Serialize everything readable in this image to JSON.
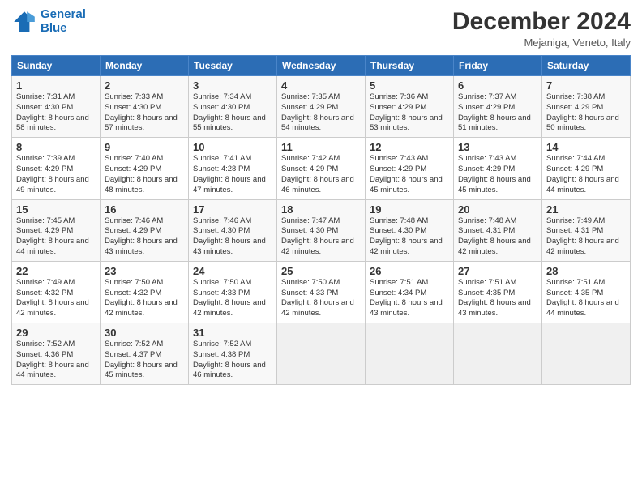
{
  "logo": {
    "line1": "General",
    "line2": "Blue"
  },
  "title": "December 2024",
  "subtitle": "Mejaniga, Veneto, Italy",
  "days_header": [
    "Sunday",
    "Monday",
    "Tuesday",
    "Wednesday",
    "Thursday",
    "Friday",
    "Saturday"
  ],
  "weeks": [
    [
      {
        "day": "1",
        "sunrise": "Sunrise: 7:31 AM",
        "sunset": "Sunset: 4:30 PM",
        "daylight": "Daylight: 8 hours and 58 minutes."
      },
      {
        "day": "2",
        "sunrise": "Sunrise: 7:33 AM",
        "sunset": "Sunset: 4:30 PM",
        "daylight": "Daylight: 8 hours and 57 minutes."
      },
      {
        "day": "3",
        "sunrise": "Sunrise: 7:34 AM",
        "sunset": "Sunset: 4:30 PM",
        "daylight": "Daylight: 8 hours and 55 minutes."
      },
      {
        "day": "4",
        "sunrise": "Sunrise: 7:35 AM",
        "sunset": "Sunset: 4:29 PM",
        "daylight": "Daylight: 8 hours and 54 minutes."
      },
      {
        "day": "5",
        "sunrise": "Sunrise: 7:36 AM",
        "sunset": "Sunset: 4:29 PM",
        "daylight": "Daylight: 8 hours and 53 minutes."
      },
      {
        "day": "6",
        "sunrise": "Sunrise: 7:37 AM",
        "sunset": "Sunset: 4:29 PM",
        "daylight": "Daylight: 8 hours and 51 minutes."
      },
      {
        "day": "7",
        "sunrise": "Sunrise: 7:38 AM",
        "sunset": "Sunset: 4:29 PM",
        "daylight": "Daylight: 8 hours and 50 minutes."
      }
    ],
    [
      {
        "day": "8",
        "sunrise": "Sunrise: 7:39 AM",
        "sunset": "Sunset: 4:29 PM",
        "daylight": "Daylight: 8 hours and 49 minutes."
      },
      {
        "day": "9",
        "sunrise": "Sunrise: 7:40 AM",
        "sunset": "Sunset: 4:29 PM",
        "daylight": "Daylight: 8 hours and 48 minutes."
      },
      {
        "day": "10",
        "sunrise": "Sunrise: 7:41 AM",
        "sunset": "Sunset: 4:28 PM",
        "daylight": "Daylight: 8 hours and 47 minutes."
      },
      {
        "day": "11",
        "sunrise": "Sunrise: 7:42 AM",
        "sunset": "Sunset: 4:29 PM",
        "daylight": "Daylight: 8 hours and 46 minutes."
      },
      {
        "day": "12",
        "sunrise": "Sunrise: 7:43 AM",
        "sunset": "Sunset: 4:29 PM",
        "daylight": "Daylight: 8 hours and 45 minutes."
      },
      {
        "day": "13",
        "sunrise": "Sunrise: 7:43 AM",
        "sunset": "Sunset: 4:29 PM",
        "daylight": "Daylight: 8 hours and 45 minutes."
      },
      {
        "day": "14",
        "sunrise": "Sunrise: 7:44 AM",
        "sunset": "Sunset: 4:29 PM",
        "daylight": "Daylight: 8 hours and 44 minutes."
      }
    ],
    [
      {
        "day": "15",
        "sunrise": "Sunrise: 7:45 AM",
        "sunset": "Sunset: 4:29 PM",
        "daylight": "Daylight: 8 hours and 44 minutes."
      },
      {
        "day": "16",
        "sunrise": "Sunrise: 7:46 AM",
        "sunset": "Sunset: 4:29 PM",
        "daylight": "Daylight: 8 hours and 43 minutes."
      },
      {
        "day": "17",
        "sunrise": "Sunrise: 7:46 AM",
        "sunset": "Sunset: 4:30 PM",
        "daylight": "Daylight: 8 hours and 43 minutes."
      },
      {
        "day": "18",
        "sunrise": "Sunrise: 7:47 AM",
        "sunset": "Sunset: 4:30 PM",
        "daylight": "Daylight: 8 hours and 42 minutes."
      },
      {
        "day": "19",
        "sunrise": "Sunrise: 7:48 AM",
        "sunset": "Sunset: 4:30 PM",
        "daylight": "Daylight: 8 hours and 42 minutes."
      },
      {
        "day": "20",
        "sunrise": "Sunrise: 7:48 AM",
        "sunset": "Sunset: 4:31 PM",
        "daylight": "Daylight: 8 hours and 42 minutes."
      },
      {
        "day": "21",
        "sunrise": "Sunrise: 7:49 AM",
        "sunset": "Sunset: 4:31 PM",
        "daylight": "Daylight: 8 hours and 42 minutes."
      }
    ],
    [
      {
        "day": "22",
        "sunrise": "Sunrise: 7:49 AM",
        "sunset": "Sunset: 4:32 PM",
        "daylight": "Daylight: 8 hours and 42 minutes."
      },
      {
        "day": "23",
        "sunrise": "Sunrise: 7:50 AM",
        "sunset": "Sunset: 4:32 PM",
        "daylight": "Daylight: 8 hours and 42 minutes."
      },
      {
        "day": "24",
        "sunrise": "Sunrise: 7:50 AM",
        "sunset": "Sunset: 4:33 PM",
        "daylight": "Daylight: 8 hours and 42 minutes."
      },
      {
        "day": "25",
        "sunrise": "Sunrise: 7:50 AM",
        "sunset": "Sunset: 4:33 PM",
        "daylight": "Daylight: 8 hours and 42 minutes."
      },
      {
        "day": "26",
        "sunrise": "Sunrise: 7:51 AM",
        "sunset": "Sunset: 4:34 PM",
        "daylight": "Daylight: 8 hours and 43 minutes."
      },
      {
        "day": "27",
        "sunrise": "Sunrise: 7:51 AM",
        "sunset": "Sunset: 4:35 PM",
        "daylight": "Daylight: 8 hours and 43 minutes."
      },
      {
        "day": "28",
        "sunrise": "Sunrise: 7:51 AM",
        "sunset": "Sunset: 4:35 PM",
        "daylight": "Daylight: 8 hours and 44 minutes."
      }
    ],
    [
      {
        "day": "29",
        "sunrise": "Sunrise: 7:52 AM",
        "sunset": "Sunset: 4:36 PM",
        "daylight": "Daylight: 8 hours and 44 minutes."
      },
      {
        "day": "30",
        "sunrise": "Sunrise: 7:52 AM",
        "sunset": "Sunset: 4:37 PM",
        "daylight": "Daylight: 8 hours and 45 minutes."
      },
      {
        "day": "31",
        "sunrise": "Sunrise: 7:52 AM",
        "sunset": "Sunset: 4:38 PM",
        "daylight": "Daylight: 8 hours and 46 minutes."
      },
      null,
      null,
      null,
      null
    ]
  ]
}
